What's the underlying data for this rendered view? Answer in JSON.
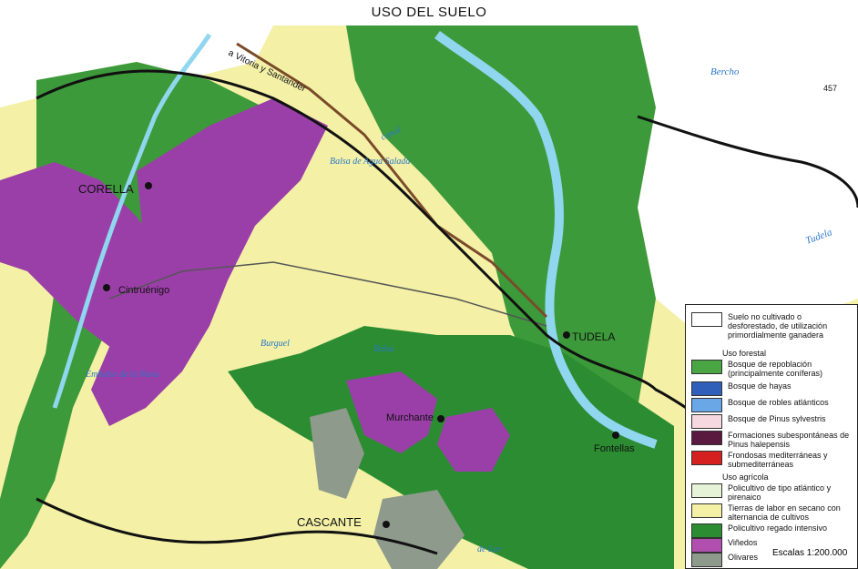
{
  "title": "USO DEL SUELO",
  "colors": {
    "cereal": "#f4f1a6",
    "forest": "#3d9a3a",
    "irrigated": "#2c8c32",
    "vineyard": "#9b3fa8",
    "olive": "#8e9a8c",
    "river": "#8fd6ee",
    "uncultivated": "#ffffff",
    "lightgreen": "#dcefc4"
  },
  "places": {
    "corella": "CORELLA",
    "cintruenigo": "Cintruénigo",
    "tudela": "TUDELA",
    "murchante": "Murchante",
    "fontellas": "Fontellas",
    "cascante": "CASCANTE"
  },
  "features": {
    "road": "a Vitoria y Santander",
    "balsa_agua": "Balsa de Agua Salada",
    "embalse_nava": "Embalse de la Nava",
    "bercho": "Bercho",
    "tudela_river": "Tudela",
    "canal": "canal",
    "burguel": "Burguel",
    "balsa_b": "Balsa",
    "lor": "de Lor",
    "elevation": "457"
  },
  "legend": {
    "uncultivated": "Suelo no cultivado o desforestado, de utilización primordialmente ganadera",
    "forestal_heading": "Uso forestal",
    "repoblacion": "Bosque de repoblación (principalmente coníferas)",
    "hayas": "Bosque de hayas",
    "robles": "Bosque de robles atlánticos",
    "pinus_sylvestris": "Bosque de Pinus sylvestris",
    "halepensis": "Formaciones subespontáneas de Pinus halepensis",
    "frondosas": "Frondosas mediterráneas y submediterráneas",
    "agricola_heading": "Uso agrícola",
    "policultivo_atlantico": "Policultivo de tipo atlántico y pirenaico",
    "secano": "Tierras de labor en secano con alternancia de cultivos",
    "regado": "Policultivo regado intensivo",
    "vinedos": "Viñedos",
    "olivares": "Olivares",
    "scale": "Escalas 1:200.000"
  },
  "legend_colors": {
    "uncultivated": "#ffffff",
    "repoblacion": "#4aa543",
    "hayas": "#2f5fb8",
    "robles": "#6aa7e6",
    "pinus_sylvestris": "#f6d8e0",
    "halepensis": "#5a1a40",
    "frondosas": "#d61f1f",
    "policultivo_atlantico": "#e6f3d6",
    "secano": "#f4f1a6",
    "regado": "#2c8c32",
    "vinedos": "#b04fb0",
    "olivares": "#8e9a8c"
  }
}
